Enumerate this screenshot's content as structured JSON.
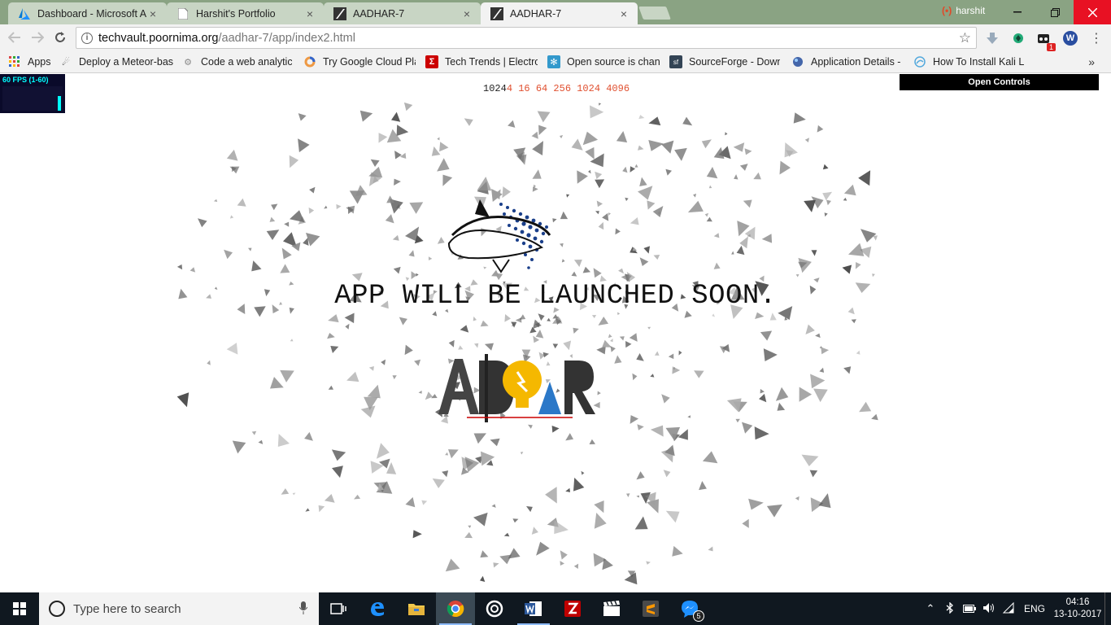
{
  "browser": {
    "tabs": [
      {
        "title": "Dashboard - Microsoft A",
        "active": false,
        "icon": "azure-icon"
      },
      {
        "title": "Harshit's Portfolio",
        "active": false,
        "icon": "page-icon"
      },
      {
        "title": "AADHAR-7",
        "active": false,
        "icon": "aadhar-favicon-icon"
      },
      {
        "title": "AADHAR-7",
        "active": true,
        "icon": "aadhar-favicon-icon"
      }
    ],
    "profile_name": "harshit",
    "close_glyph": "×",
    "url": {
      "host": "techvault.poornima.org",
      "path": "/aadhar-7/app/index2.html"
    },
    "extension_badge": "1",
    "extension_w": "W"
  },
  "bookmarks": [
    {
      "label": "Apps",
      "icon": "apps-grid-icon",
      "color": "#d44"
    },
    {
      "label": "Deploy a Meteor-bas",
      "icon": "meteor-icon",
      "color": "#333"
    },
    {
      "label": "Code a web analytics",
      "icon": "gear-icon",
      "color": "#888"
    },
    {
      "label": "Try Google Cloud Plat",
      "icon": "google-cloud-icon",
      "color": "#e94"
    },
    {
      "label": "Tech Trends | Electron",
      "icon": "sigma-icon",
      "color": "#c00"
    },
    {
      "label": "Open source is chang",
      "icon": "snowflake-icon",
      "color": "#39c"
    },
    {
      "label": "SourceForge - Downl",
      "icon": "sourceforge-icon",
      "color": "#345"
    },
    {
      "label": "Application Details - ",
      "icon": "app-details-icon",
      "color": "#46a"
    },
    {
      "label": "How To Install Kali Lin",
      "icon": "kali-icon",
      "color": "#5ad"
    }
  ],
  "page": {
    "fps_label": "60 FPS (1-60)",
    "open_controls": "Open Controls",
    "numbers_prefix": "1024",
    "numbers_sequence": "4 16 64 256 1024 4096",
    "headline": "APP WILL BE LAUNCHED SOON."
  },
  "taskbar": {
    "search_placeholder": "Type here to search",
    "language": "ENG",
    "time": "04:16",
    "date": "13-10-2017",
    "messenger_badge": "5"
  }
}
